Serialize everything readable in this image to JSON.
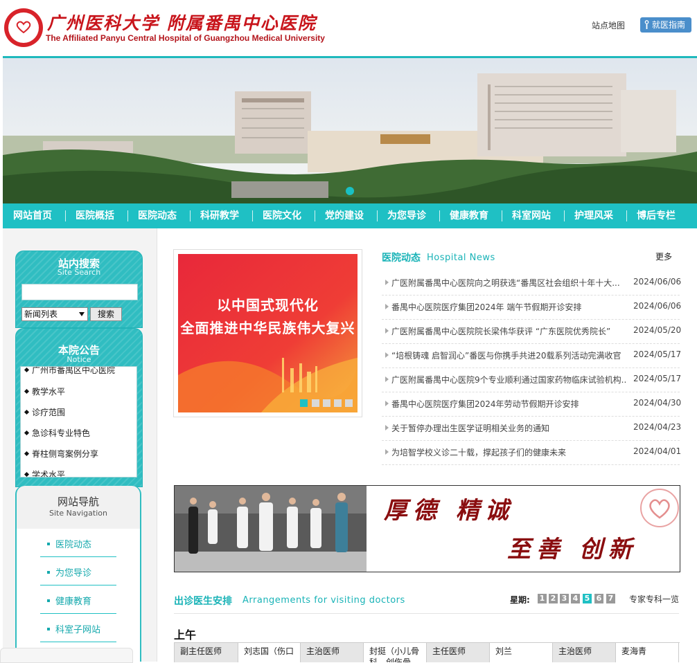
{
  "header": {
    "logo_cn": "广州医科大学 附属番禺中心医院",
    "logo_en": "The Affiliated Panyu Central Hospital of Guangzhou Medical University",
    "sitemap": "站点地图",
    "guide": "就医指南"
  },
  "nav": [
    "网站首页",
    "医院概括",
    "医院动态",
    "科研教学",
    "医院文化",
    "党的建设",
    "为您导诊",
    "健康教育",
    "科室网站",
    "护理风采",
    "博后专栏"
  ],
  "search": {
    "title": "站内搜索",
    "subtitle": "Site Search",
    "select": "新闻列表",
    "button": "搜索"
  },
  "notice": {
    "title": "本院公告",
    "subtitle": "Notice",
    "items": [
      "广州市番禺区中心医院",
      "教学水平",
      "诊疗范围",
      "急诊科专业特色",
      "脊柱侧弯案例分享",
      "学术水平"
    ]
  },
  "site_nav": {
    "title": "网站导航",
    "subtitle": "Site Navigation",
    "items": [
      "医院动态",
      "为您导诊",
      "健康教育",
      "科室子网站"
    ]
  },
  "slide": {
    "line1": "以中国式现代化",
    "line2": "全面推进中华民族伟大复兴"
  },
  "news": {
    "title": "医院动态",
    "title_en": "Hospital News",
    "more": "更多",
    "items": [
      {
        "title": "广医附属番禺中心医院向之明获选“番禺区社会组织十年十大...",
        "date": "2024/06/06"
      },
      {
        "title": "番禺中心医院医疗集团2024年 端午节假期开诊安排",
        "date": "2024/06/06"
      },
      {
        "title": "广医附属番禺中心医院院长梁伟华获评 “广东医院优秀院长”",
        "date": "2024/05/20"
      },
      {
        "title": "“培根铸魂 启智润心”番医与你携手共进20载系列活动完满收官",
        "date": "2024/05/17"
      },
      {
        "title": "广医附属番禺中心医院9个专业顺利通过国家药物临床试验机构...",
        "date": "2024/05/17"
      },
      {
        "title": "番禺中心医院医疗集团2024年劳动节假期开诊安排",
        "date": "2024/04/30"
      },
      {
        "title": "关于暂停办理出生医学证明相关业务的通知",
        "date": "2024/04/23"
      },
      {
        "title": "为培智学校义诊二十载，撑起孩子们的健康未来",
        "date": "2024/04/01"
      }
    ]
  },
  "motto": {
    "line1": "厚德 精诚",
    "line2": "至善 创新"
  },
  "schedule": {
    "title": "出诊医生安排",
    "title_en": "Arrangements for visiting doctors",
    "week_label": "星期:",
    "days": [
      "1",
      "2",
      "3",
      "4",
      "5",
      "6",
      "7"
    ],
    "active_day": "5",
    "all_link": "专家专科一览",
    "period": "上午",
    "cells": [
      "副主任医师",
      "刘志国（伤口",
      "主治医师",
      "封挺（小儿骨科、创伤骨",
      "主任医师",
      "刘兰",
      "主治医师",
      "麦海青"
    ]
  },
  "colors": {
    "accent": "#1fc0c4",
    "brand_red": "#c8141b"
  }
}
